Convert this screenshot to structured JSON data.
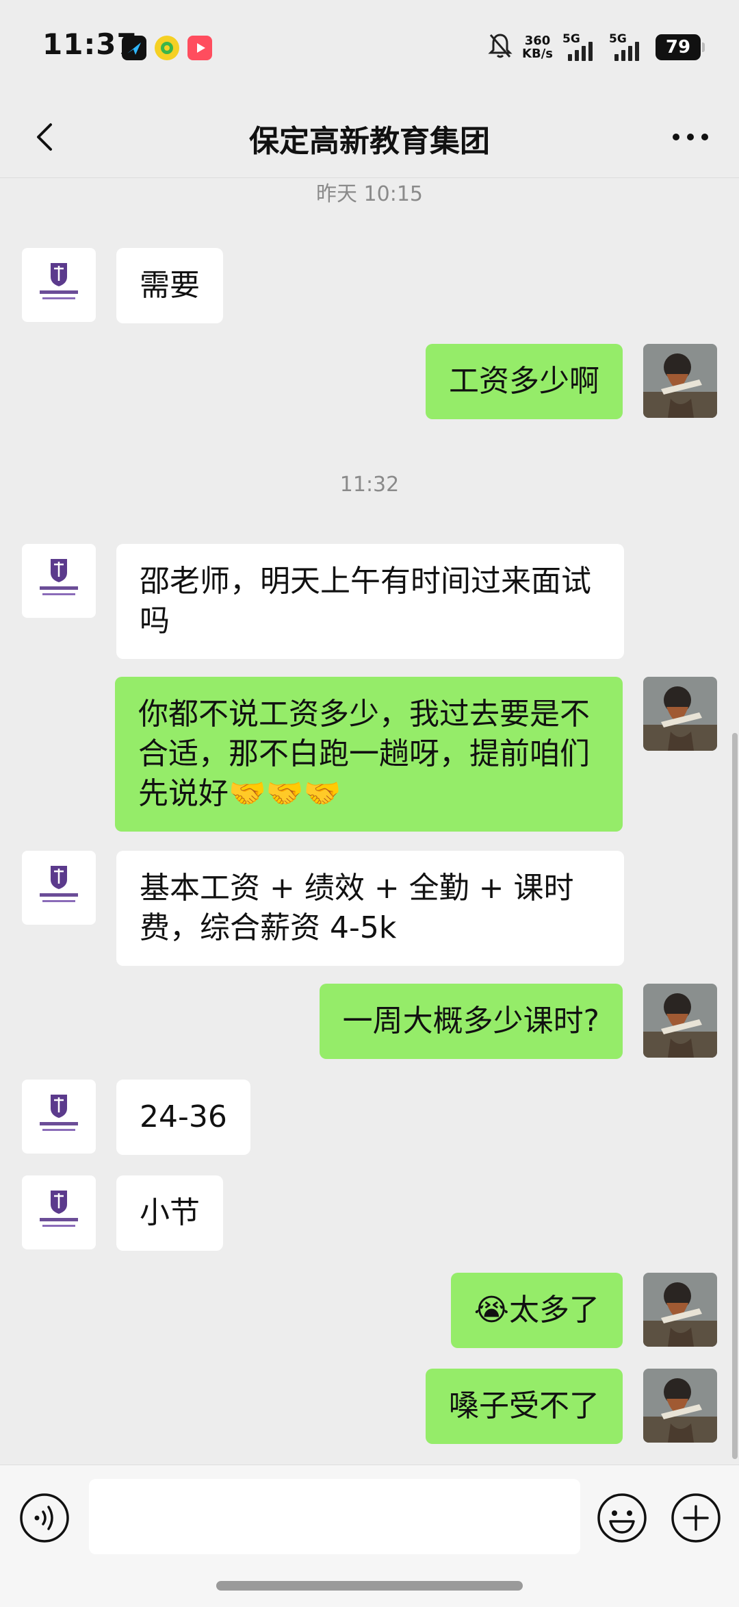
{
  "status_bar": {
    "time": "11:37",
    "net_speed_value": "360",
    "net_speed_unit": "KB/s",
    "sim1": "5G",
    "sim2": "5G",
    "battery": "79"
  },
  "header": {
    "title": "保定高新教育集团"
  },
  "messages": [
    {
      "type": "timestamp",
      "text": "昨天 10:15"
    },
    {
      "type": "in",
      "text": "需要"
    },
    {
      "type": "out",
      "text": "工资多少啊"
    },
    {
      "type": "timestamp",
      "text": "11:32"
    },
    {
      "type": "in",
      "text": "邵老师，明天上午有时间过来面试吗"
    },
    {
      "type": "out",
      "text": "你都不说工资多少，我过去要是不合适，那不白跑一趟呀，提前咱们先说好🤝🤝🤝"
    },
    {
      "type": "in",
      "text": "基本工资 + 绩效 + 全勤 + 课时费，综合薪资 4-5k"
    },
    {
      "type": "out",
      "text": "一周大概多少课时?"
    },
    {
      "type": "in",
      "text": "24-36"
    },
    {
      "type": "in",
      "text": "小节"
    },
    {
      "type": "out",
      "text": "😭太多了"
    },
    {
      "type": "out",
      "text": "嗓子受不了"
    }
  ],
  "input": {
    "value": ""
  },
  "colors": {
    "outgoing_bubble": "#95ec69",
    "incoming_bubble": "#ffffff",
    "chat_background": "#ededed",
    "logo_purple": "#5b3a8c"
  },
  "icons": {
    "back": "chevron-left-icon",
    "more": "more-dots-icon",
    "voice": "voice-icon",
    "emoji": "emoji-icon",
    "plus": "plus-icon",
    "mute": "bell-off-icon"
  }
}
